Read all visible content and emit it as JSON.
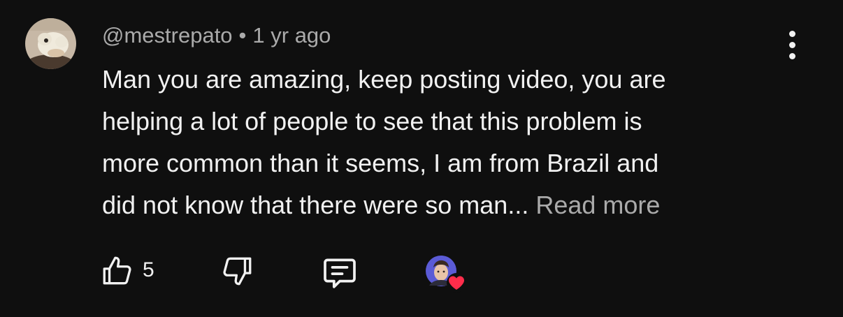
{
  "comment": {
    "author": "@mestrepato",
    "separator": "•",
    "timestamp": "1 yr ago",
    "text_lines": [
      "Man you are amazing, keep posting video, you are",
      "helping a lot of people to see that this problem is",
      "more common than it seems, I am from Brazil and",
      "did not know that there were so man..."
    ],
    "read_more_label": "Read more",
    "like_count": "5"
  },
  "icons": {
    "like": "thumbs-up-icon",
    "dislike": "thumbs-down-icon",
    "reply": "comment-reply-icon",
    "menu": "more-vertical-icon",
    "heart": "heart-icon"
  },
  "colors": {
    "background": "#0f0f0f",
    "text_primary": "#f1f1f1",
    "text_secondary": "#aaaaaa",
    "heart": "#ff2d4b"
  }
}
